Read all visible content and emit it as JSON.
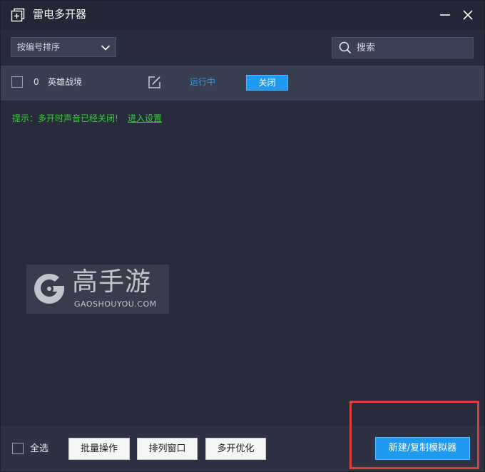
{
  "window": {
    "title": "雷电多开器",
    "icons": {
      "app": "add-window-icon",
      "minimize": "minimize-icon",
      "close": "close-icon"
    }
  },
  "toolbar": {
    "sort_label": "按编号排序",
    "sort_icon": "chevron-down-icon",
    "search_placeholder": "搜索",
    "search_value": "",
    "search_icon": "search-icon"
  },
  "instances": [
    {
      "index": "0",
      "name": "英雄战境",
      "status": "运行中",
      "action_label": "关闭",
      "checked": false,
      "edit_icon": "edit-icon"
    }
  ],
  "hint": {
    "text": "提示：多开时声音已经关闭!",
    "link": "进入设置"
  },
  "watermark": {
    "cn": "高手游",
    "en": "GAOSHOUYOU.COM"
  },
  "bottom": {
    "select_all_label": "全选",
    "batch_label": "批量操作",
    "arrange_label": "排列窗口",
    "optimize_label": "多开优化",
    "new_label": "新建/复制模拟器"
  },
  "colors": {
    "background": "#282b3c",
    "titlebar": "#232635",
    "row": "#3a3e51",
    "accent": "#1e9af0",
    "status": "#2d9be6",
    "hint": "#38cf36",
    "highlight": "#d8403f"
  }
}
